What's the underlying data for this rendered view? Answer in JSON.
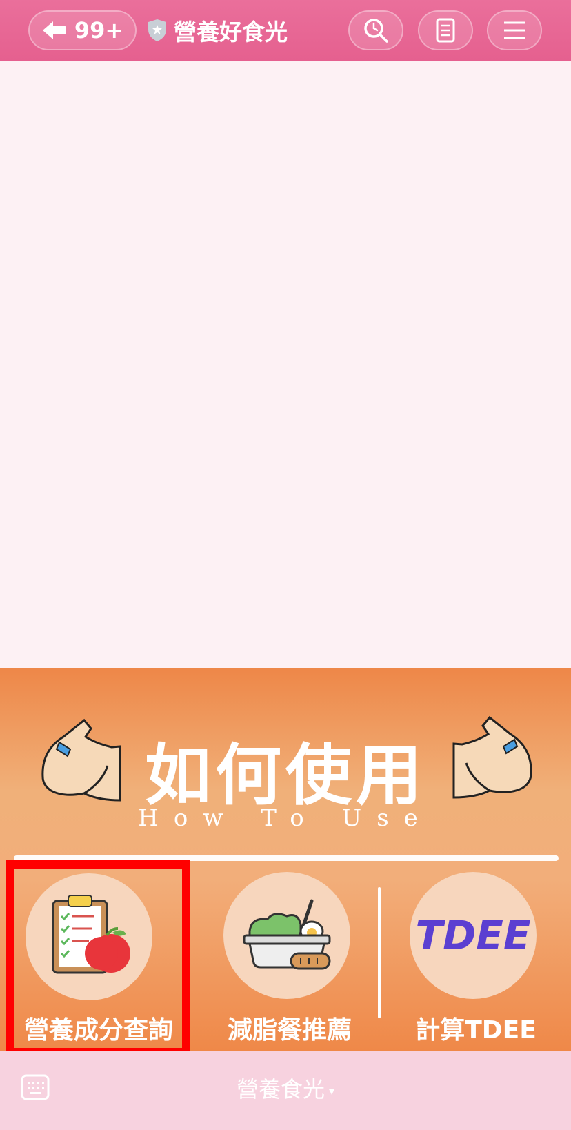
{
  "header": {
    "back_count": "99+",
    "title": "營養好食光",
    "icons": [
      "back-arrow-icon",
      "shield-star-icon",
      "search-icon",
      "notes-icon",
      "hamburger-menu-icon"
    ]
  },
  "rich_menu": {
    "title": "如何使用",
    "subtitle": "How To Use",
    "items": [
      {
        "label": "營養成分查詢",
        "icon": "clipboard-apple-icon"
      },
      {
        "label": "減脂餐推薦",
        "icon": "meal-box-icon"
      },
      {
        "label": "計算TDEE",
        "icon_text": "TDEE"
      }
    ]
  },
  "bottom_bar": {
    "menu_label": "營養食光",
    "caret": "▾",
    "icons": [
      "keyboard-icon"
    ]
  },
  "colors": {
    "header": "#e5608f",
    "chat_bg": "#fdf1f4",
    "menu_orange": "#ee8748",
    "highlight": "#ff0000",
    "tdee_text": "#5b3fd1",
    "bottom_bar": "#f7d2df"
  }
}
